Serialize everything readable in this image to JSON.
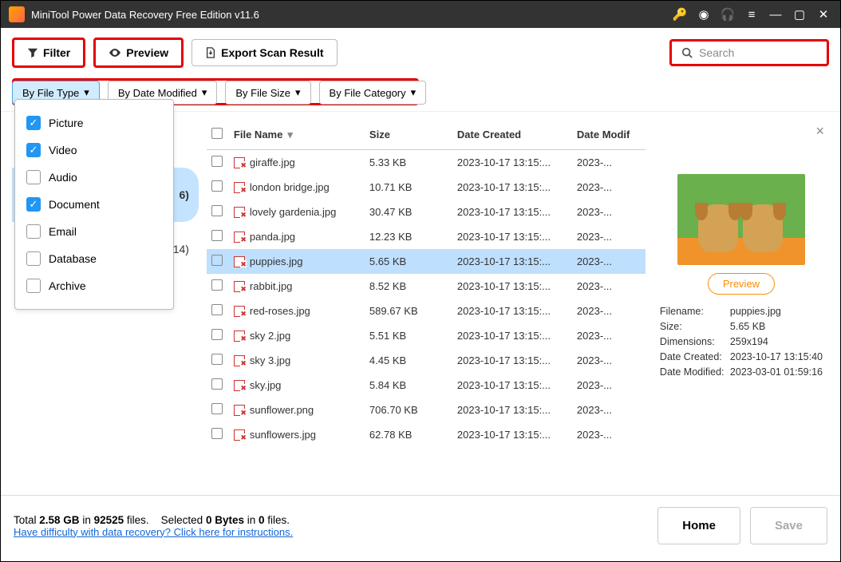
{
  "title": "MiniTool Power Data Recovery Free Edition v11.6",
  "toolbar": {
    "filter": "Filter",
    "preview": "Preview",
    "export": "Export Scan Result"
  },
  "search": {
    "placeholder": "Search"
  },
  "filters": {
    "by_type": "By File Type",
    "by_date": "By Date Modified",
    "by_size": "By File Size",
    "by_category": "By File Category"
  },
  "filetype_options": [
    {
      "label": "Picture",
      "checked": true
    },
    {
      "label": "Video",
      "checked": true
    },
    {
      "label": "Audio",
      "checked": false
    },
    {
      "label": "Document",
      "checked": true
    },
    {
      "label": "Email",
      "checked": false
    },
    {
      "label": "Database",
      "checked": false
    },
    {
      "label": "Archive",
      "checked": false
    }
  ],
  "side_hints": [
    {
      "text": "6)",
      "selected": true
    },
    {
      "text": "14)",
      "selected": false
    }
  ],
  "columns": {
    "name": "File Name",
    "size": "Size",
    "created": "Date Created",
    "modified": "Date Modif"
  },
  "files": [
    {
      "name": "giraffe.jpg",
      "size": "5.33 KB",
      "created": "2023-10-17 13:15:...",
      "modified": "2023-...",
      "selected": false
    },
    {
      "name": "london bridge.jpg",
      "size": "10.71 KB",
      "created": "2023-10-17 13:15:...",
      "modified": "2023-...",
      "selected": false
    },
    {
      "name": "lovely gardenia.jpg",
      "size": "30.47 KB",
      "created": "2023-10-17 13:15:...",
      "modified": "2023-...",
      "selected": false
    },
    {
      "name": "panda.jpg",
      "size": "12.23 KB",
      "created": "2023-10-17 13:15:...",
      "modified": "2023-...",
      "selected": false
    },
    {
      "name": "puppies.jpg",
      "size": "5.65 KB",
      "created": "2023-10-17 13:15:...",
      "modified": "2023-...",
      "selected": true
    },
    {
      "name": "rabbit.jpg",
      "size": "8.52 KB",
      "created": "2023-10-17 13:15:...",
      "modified": "2023-...",
      "selected": false
    },
    {
      "name": "red-roses.jpg",
      "size": "589.67 KB",
      "created": "2023-10-17 13:15:...",
      "modified": "2023-...",
      "selected": false
    },
    {
      "name": "sky 2.jpg",
      "size": "5.51 KB",
      "created": "2023-10-17 13:15:...",
      "modified": "2023-...",
      "selected": false
    },
    {
      "name": "sky 3.jpg",
      "size": "4.45 KB",
      "created": "2023-10-17 13:15:...",
      "modified": "2023-...",
      "selected": false
    },
    {
      "name": "sky.jpg",
      "size": "5.84 KB",
      "created": "2023-10-17 13:15:...",
      "modified": "2023-...",
      "selected": false
    },
    {
      "name": "sunflower.png",
      "size": "706.70 KB",
      "created": "2023-10-17 13:15:...",
      "modified": "2023-...",
      "selected": false
    },
    {
      "name": "sunflowers.jpg",
      "size": "62.78 KB",
      "created": "2023-10-17 13:15:...",
      "modified": "2023-...",
      "selected": false
    }
  ],
  "preview": {
    "button": "Preview",
    "labels": {
      "filename": "Filename:",
      "size": "Size:",
      "dimensions": "Dimensions:",
      "created": "Date Created:",
      "modified": "Date Modified:"
    },
    "values": {
      "filename": "puppies.jpg",
      "size": "5.65 KB",
      "dimensions": "259x194",
      "created": "2023-10-17 13:15:40",
      "modified": "2023-03-01 01:59:16"
    }
  },
  "footer": {
    "total_prefix": "Total ",
    "total_size": "2.58 GB",
    "total_mid": " in ",
    "total_files": "92525",
    "total_suffix": " files.",
    "sel_prefix": "Selected ",
    "sel_bytes": "0 Bytes",
    "sel_mid": " in ",
    "sel_files": "0",
    "sel_suffix": " files.",
    "help_link": "Have difficulty with data recovery? Click here for instructions.",
    "home": "Home",
    "save": "Save"
  }
}
